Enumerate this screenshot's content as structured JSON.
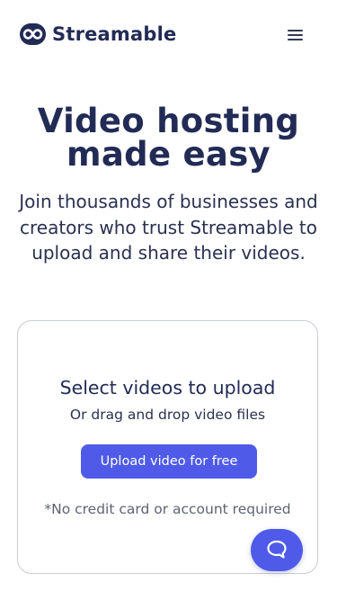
{
  "header": {
    "logo_text": "Streamable",
    "menu_icon": "hamburger-menu-icon",
    "logo_icon": "infinity-logo-icon"
  },
  "hero": {
    "title_line1": "Video hosting",
    "title_line2": "made easy",
    "subtitle": "Join thousands of businesses and creators who trust Streamable to upload and share their videos."
  },
  "upload": {
    "title": "Select videos to upload",
    "subtitle": "Or drag and drop video files",
    "button_label": "Upload video for free",
    "note": "*No credit card or account required"
  },
  "chat": {
    "icon": "chat-bubble-icon"
  },
  "colors": {
    "brand": "#222b55",
    "accent": "#4f5be8"
  }
}
